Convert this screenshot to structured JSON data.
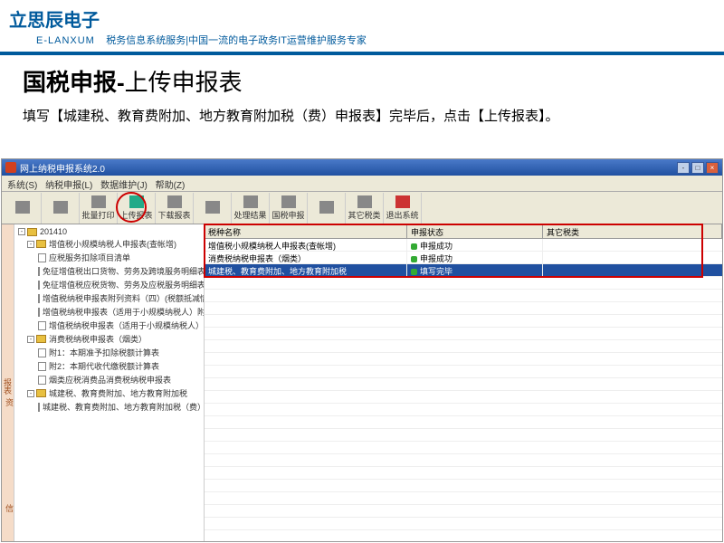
{
  "brand": {
    "logo": "立思辰电子",
    "sub": "E-LANXUM",
    "tag": "税务信息系统服务|中国一流的电子政务IT运营维护服务专家"
  },
  "page": {
    "t1": "国税申报-",
    "t2": "上传申报表",
    "desc": "填写【城建税、教育费附加、地方教育附加税（费）申报表】完毕后，点击【上传报表】。"
  },
  "win": {
    "title": "网上纳税申报系统2.0"
  },
  "menu": {
    "m1": "系统(S)",
    "m2": "纳税申报(L)",
    "m3": "数据维护(J)",
    "m4": "帮助(Z)"
  },
  "tb": {
    "b1": "",
    "b2": "",
    "b3": "批量打印",
    "b4": "上传报表",
    "b5": "下载报表",
    "b6": "",
    "b7": "处理结果",
    "b8": "国税申报",
    "b9": "",
    "b10": "其它税类",
    "b11": "退出系统"
  },
  "tree": {
    "root": "201410",
    "g1": "增值税小规模纳税人申报表(查帐增)",
    "g1a": "应税服务扣除项目清单",
    "g1b": "免征增值税出口货物、劳务及跨境服务明细表",
    "g1c": "免征增值税应税货物、劳务及应税服务明细表",
    "g1d": "增值税纳税申报表附列资料（四）(税额抵减情况表)",
    "g1e": "增值税纳税申报表（适用于小规模纳税人）附列资料",
    "g1f": "增值税纳税申报表（适用于小规模纳税人）",
    "g2": "消费税纳税申报表（烟类）",
    "g2a": "附1：本期准予扣除税额计算表",
    "g2b": "附2：本期代收代缴税额计算表",
    "g2c": "烟类应税消费品消费税纳税申报表",
    "g3": "城建税、教育费附加、地方教育附加税",
    "g3a": "城建税、教育费附加、地方教育附加税（费）申报表"
  },
  "cols": {
    "c1": "税种名称",
    "c2": "申报状态",
    "c3": "其它税类"
  },
  "rows": {
    "r1n": "增值税小规模纳税人申报表(查帐增)",
    "r1s": "申报成功",
    "r2n": "消费税纳税申报表（烟类）",
    "r2s": "申报成功",
    "r3n": "城建税、教育费附加、地方教育附加税",
    "r3s": "填写完毕"
  },
  "side": {
    "t1": "报表",
    "t2": "资",
    "t3": "信"
  }
}
